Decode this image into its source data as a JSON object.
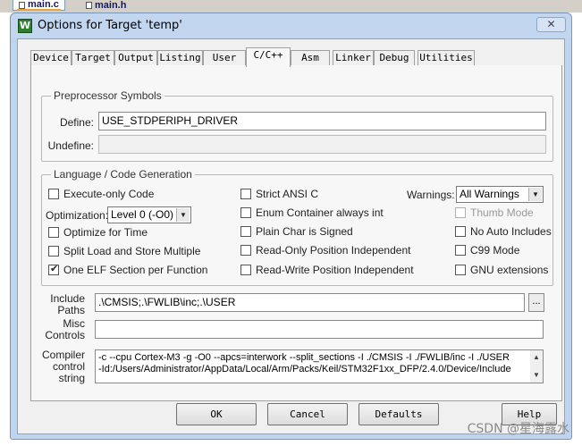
{
  "editor_tabs": [
    {
      "label": "main.c",
      "active": true
    },
    {
      "label": "main.h",
      "active": false
    }
  ],
  "dialog": {
    "title": "Options for Target 'temp'",
    "app_icon_glyph": "W",
    "close_glyph": "✕"
  },
  "tabs": [
    {
      "label": "Device"
    },
    {
      "label": "Target"
    },
    {
      "label": "Output"
    },
    {
      "label": "Listing"
    },
    {
      "label": "User"
    },
    {
      "label": "C/C++",
      "active": true
    },
    {
      "label": "Asm"
    },
    {
      "label": "Linker"
    },
    {
      "label": "Debug"
    },
    {
      "label": "Utilities"
    }
  ],
  "preprocessor": {
    "legend": "Preprocessor Symbols",
    "define_label": "Define:",
    "define_value": "USE_STDPERIPH_DRIVER",
    "undefine_label": "Undefine:",
    "undefine_value": ""
  },
  "codegen": {
    "legend": "Language / Code Generation",
    "execute_only": {
      "label": "Execute-only Code",
      "checked": false
    },
    "optimization_label": "Optimization:",
    "optimization_value": "Level 0 (-O0)",
    "optimize_time": {
      "label": "Optimize for Time",
      "checked": false
    },
    "split_load": {
      "label": "Split Load and Store Multiple",
      "checked": false
    },
    "one_elf": {
      "label": "One ELF Section per Function",
      "checked": true
    },
    "strict_ansi": {
      "label": "Strict ANSI C",
      "checked": false
    },
    "enum_container": {
      "label": "Enum Container always int",
      "checked": false
    },
    "plain_char": {
      "label": "Plain Char is Signed",
      "checked": false
    },
    "ro_pi": {
      "label": "Read-Only Position Independent",
      "checked": false
    },
    "rw_pi": {
      "label": "Read-Write Position Independent",
      "checked": false
    },
    "warnings_label": "Warnings:",
    "warnings_value": "All Warnings",
    "thumb_mode": {
      "label": "Thumb Mode",
      "checked": false,
      "disabled": true
    },
    "no_auto_includes": {
      "label": "No Auto Includes",
      "checked": false
    },
    "c99": {
      "label": "C99 Mode",
      "checked": false
    },
    "gnu_ext": {
      "label": "GNU extensions",
      "checked": false
    }
  },
  "include_paths": {
    "label_line1": "Include",
    "label_line2": "Paths",
    "value": ".\\CMSIS;.\\FWLIB\\inc;.\\USER",
    "browse_label": "..."
  },
  "misc_controls": {
    "label_line1": "Misc",
    "label_line2": "Controls",
    "value": ""
  },
  "compiler_control": {
    "label_line1": "Compiler",
    "label_line2": "control",
    "label_line3": "string",
    "line1": "-c --cpu Cortex-M3 -g -O0 --apcs=interwork --split_sections -I ./CMSIS -I ./FWLIB/inc -I ./USER",
    "line2": "-Id:/Users/Administrator/AppData/Local/Arm/Packs/Keil/STM32F1xx_DFP/2.4.0/Device/Include"
  },
  "buttons": {
    "ok": "OK",
    "cancel": "Cancel",
    "defaults": "Defaults",
    "help": "Help"
  },
  "watermark": "CSDN @星海露水"
}
